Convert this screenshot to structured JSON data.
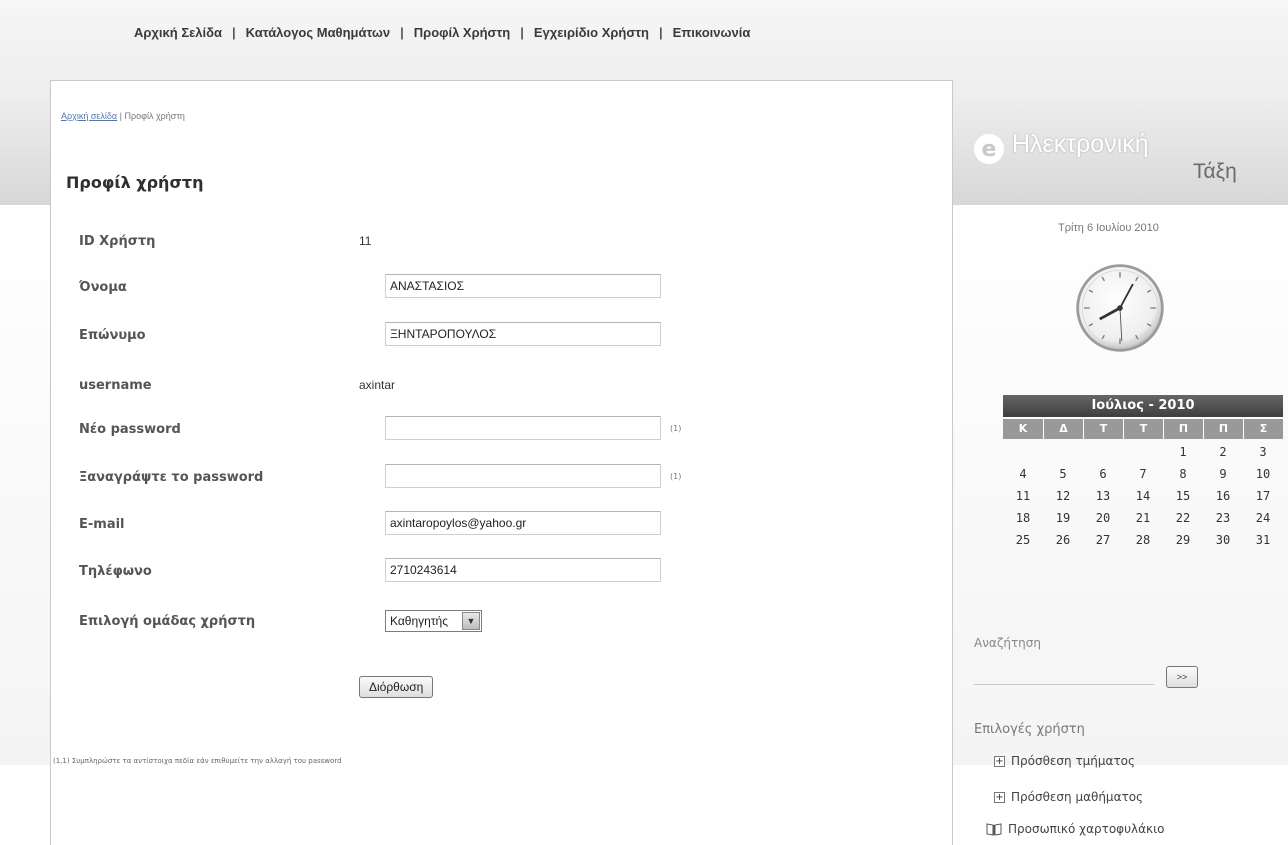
{
  "topnav": {
    "items": [
      "Αρχική Σελίδα",
      "Κατάλογος Μαθημάτων",
      "Προφίλ Χρήστη",
      "Εγχειρίδιο Χρήστη",
      "Επικοινωνία"
    ],
    "separator": "|"
  },
  "breadcrumb": {
    "home": "Αρχική σελίδα",
    "separator": " | ",
    "current": "Προφίλ χρήστη"
  },
  "page_title": "Προφίλ χρήστη",
  "form": {
    "user_id": {
      "label": "ID Χρήστη",
      "value": "11"
    },
    "first_name": {
      "label": "Όνομα",
      "value": "ΑΝΑΣΤΑΣΙΟΣ"
    },
    "last_name": {
      "label": "Επώνυμο",
      "value": "ΞΗΝΤΑΡΟΠΟΥΛΟΣ"
    },
    "username": {
      "label": "username",
      "value": "axintar"
    },
    "new_password": {
      "label": "Νέο password",
      "value": "",
      "note": "(1)"
    },
    "retype_password": {
      "label": "Ξαναγράψτε το password",
      "value": "",
      "note": "(1)"
    },
    "email": {
      "label": "E-mail",
      "value": "axintaropoylos@yahoo.gr"
    },
    "phone": {
      "label": "Τηλέφωνο",
      "value": "2710243614"
    },
    "group": {
      "label": "Επιλογή ομάδας χρήστη",
      "selected": "Καθηγητής"
    },
    "submit_label": "Διόρθωση",
    "footnote": "(1,1) Συμπληρώστε τα αντίστοιχα πεδία εάν επιθυμείτε την αλλαγή του password"
  },
  "logo": {
    "line1": "Ηλεκτρονική",
    "line2": "Τάξη"
  },
  "date_text": "Τρίτη 6 Ιουλίου 2010",
  "calendar": {
    "title": "Ιούλιος - 2010",
    "weekdays": [
      "Κ",
      "Δ",
      "Τ",
      "Τ",
      "Π",
      "Π",
      "Σ"
    ],
    "weeks": [
      [
        "",
        "",
        "",
        "",
        "1",
        "2",
        "3"
      ],
      [
        "4",
        "5",
        "6",
        "7",
        "8",
        "9",
        "10"
      ],
      [
        "11",
        "12",
        "13",
        "14",
        "15",
        "16",
        "17"
      ],
      [
        "18",
        "19",
        "20",
        "21",
        "22",
        "23",
        "24"
      ],
      [
        "25",
        "26",
        "27",
        "28",
        "29",
        "30",
        "31"
      ]
    ]
  },
  "search": {
    "label": "Αναζήτηση",
    "button": ">>"
  },
  "user_options": {
    "title": "Επιλογές χρήστη",
    "items": [
      "Πρόσθεση τμήματος",
      "Πρόσθεση μαθήματος",
      "Προσωπικό χαρτοφυλάκιο"
    ]
  }
}
